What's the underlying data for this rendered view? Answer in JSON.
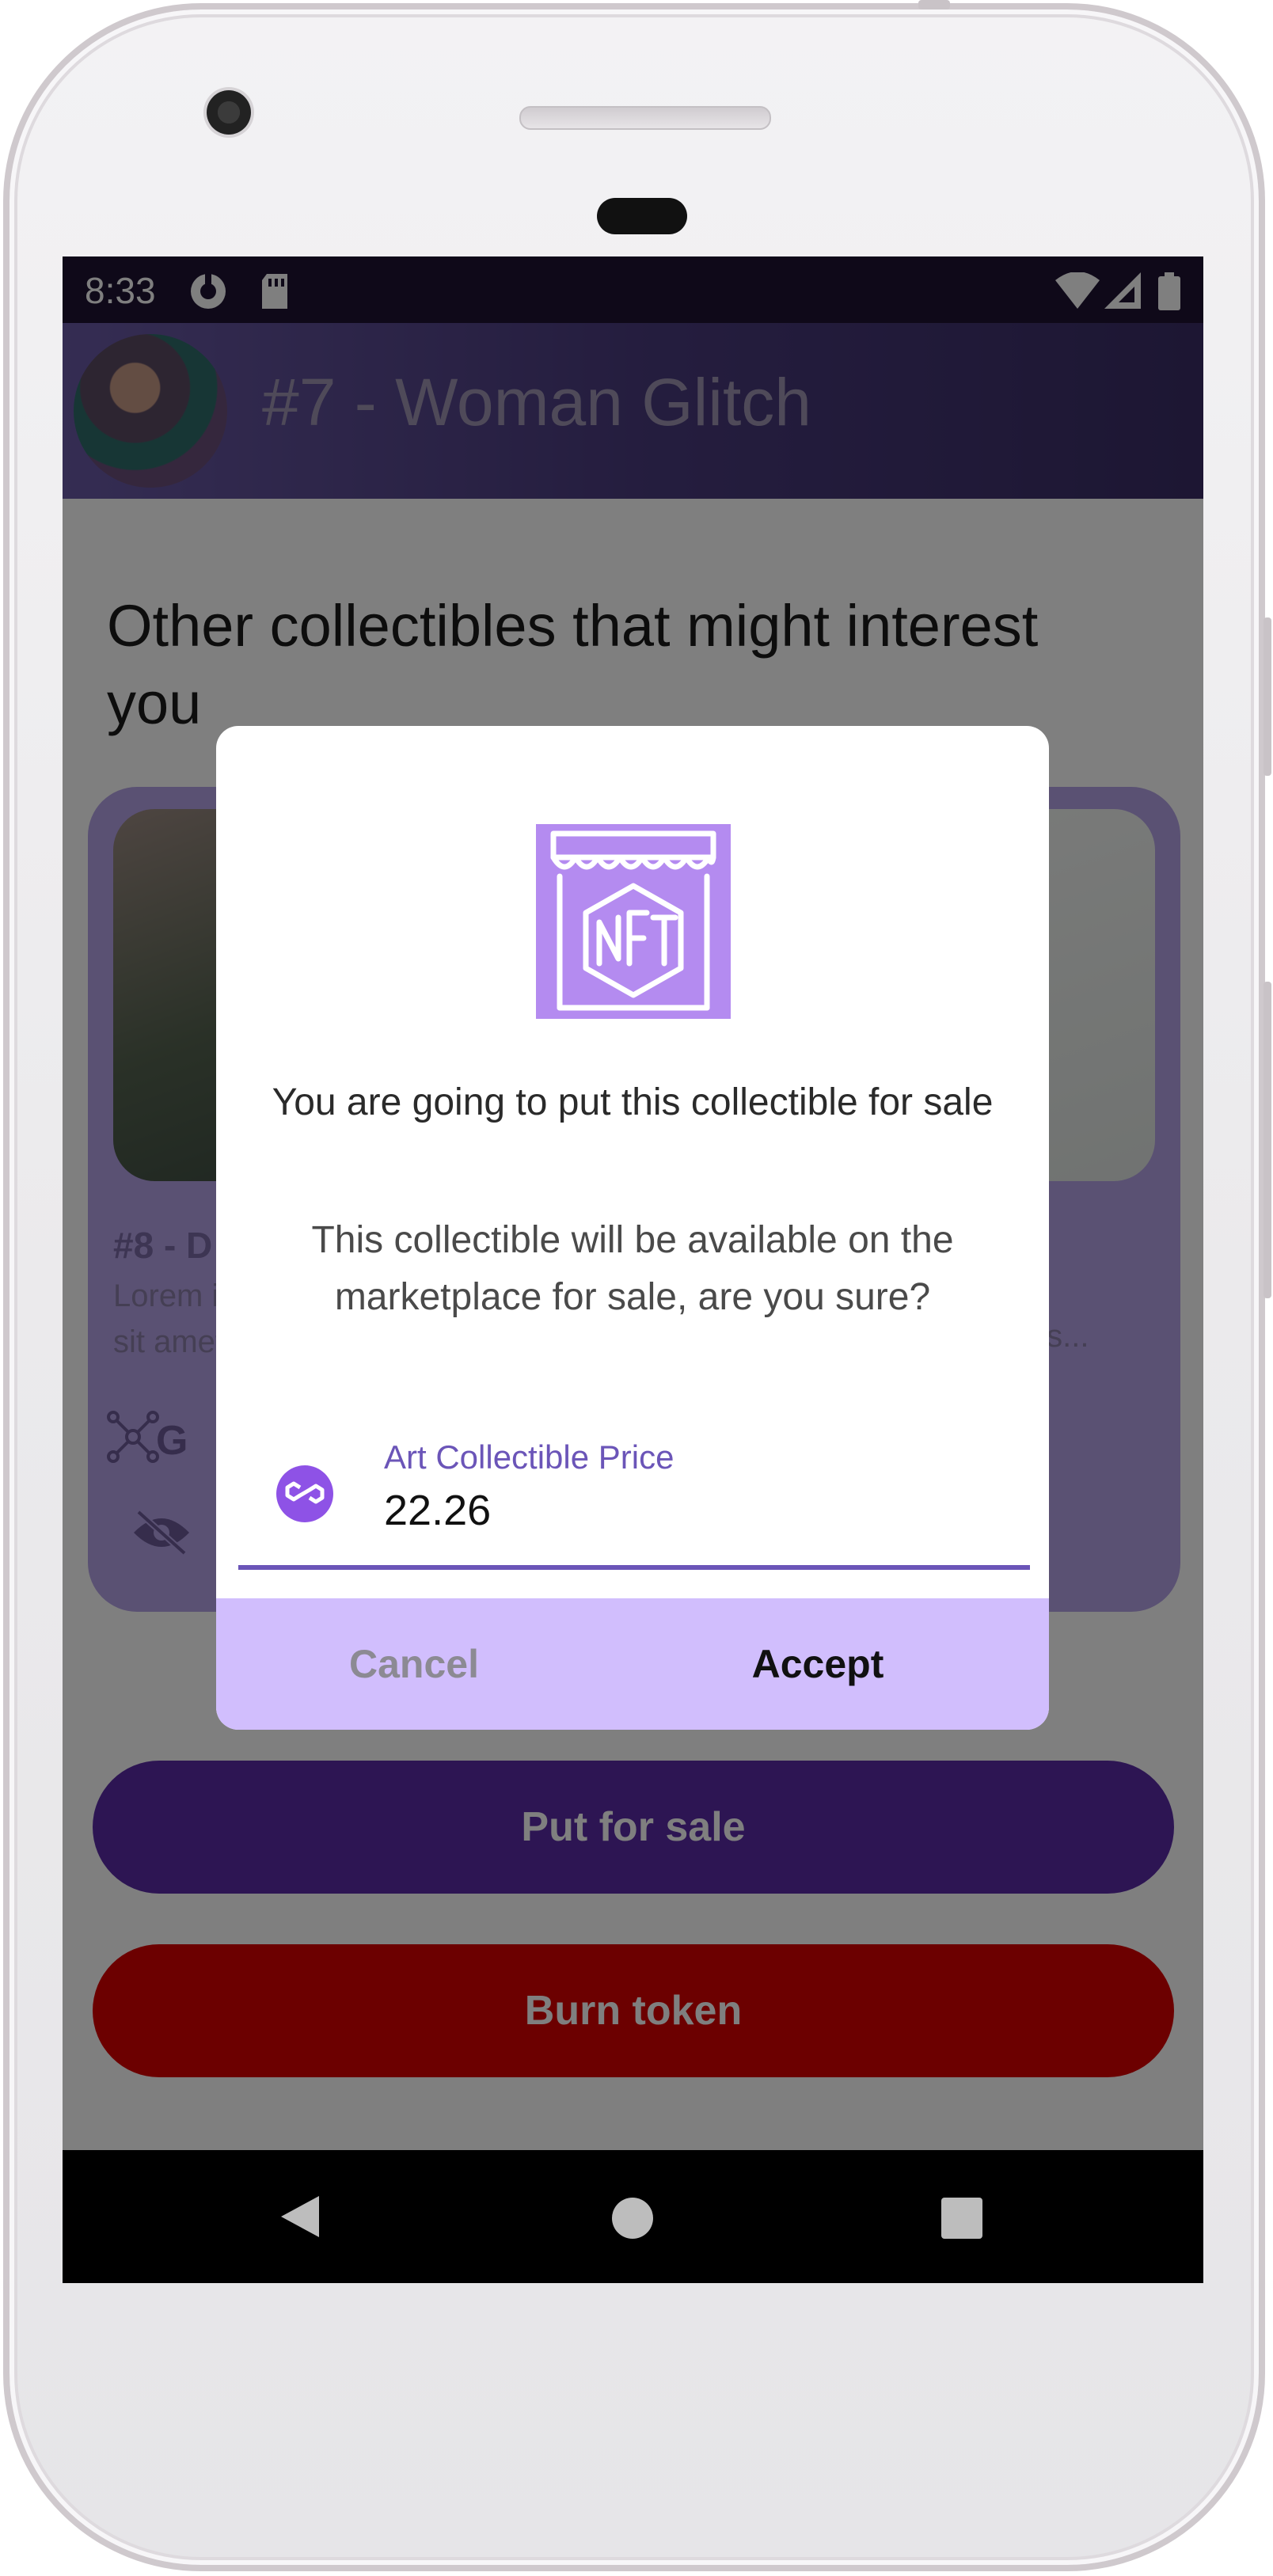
{
  "status_bar": {
    "time": "8:33"
  },
  "app_bar": {
    "title": "#7 - Woman Glitch"
  },
  "content": {
    "section_title": "Other collectibles that might interest you",
    "card": {
      "title": "#8 - D",
      "description": "Lorem ipsum dolor sit amet,",
      "description_right_fragment": "pis...",
      "owner_fragment": "G"
    },
    "buttons": {
      "put_for_sale": "Put for sale",
      "burn_token": "Burn token"
    }
  },
  "dialog": {
    "icon": "nft-store-icon",
    "heading": "You are going to put this collectible for sale",
    "body": "This collectible will be available on the marketplace for sale, are you sure?",
    "price_field": {
      "label": "Art Collectible Price",
      "value": "22.26",
      "icon": "polygon-matic-icon"
    },
    "cancel_label": "Cancel",
    "accept_label": "Accept"
  },
  "colors": {
    "status_bar": "#1e1333",
    "accent": "#6b55b8",
    "dialog_actions_bg": "#d1befd",
    "sale_button": "#5a2aa7",
    "burn_button": "#d90000",
    "nft_icon_bg": "#b48bf0"
  }
}
